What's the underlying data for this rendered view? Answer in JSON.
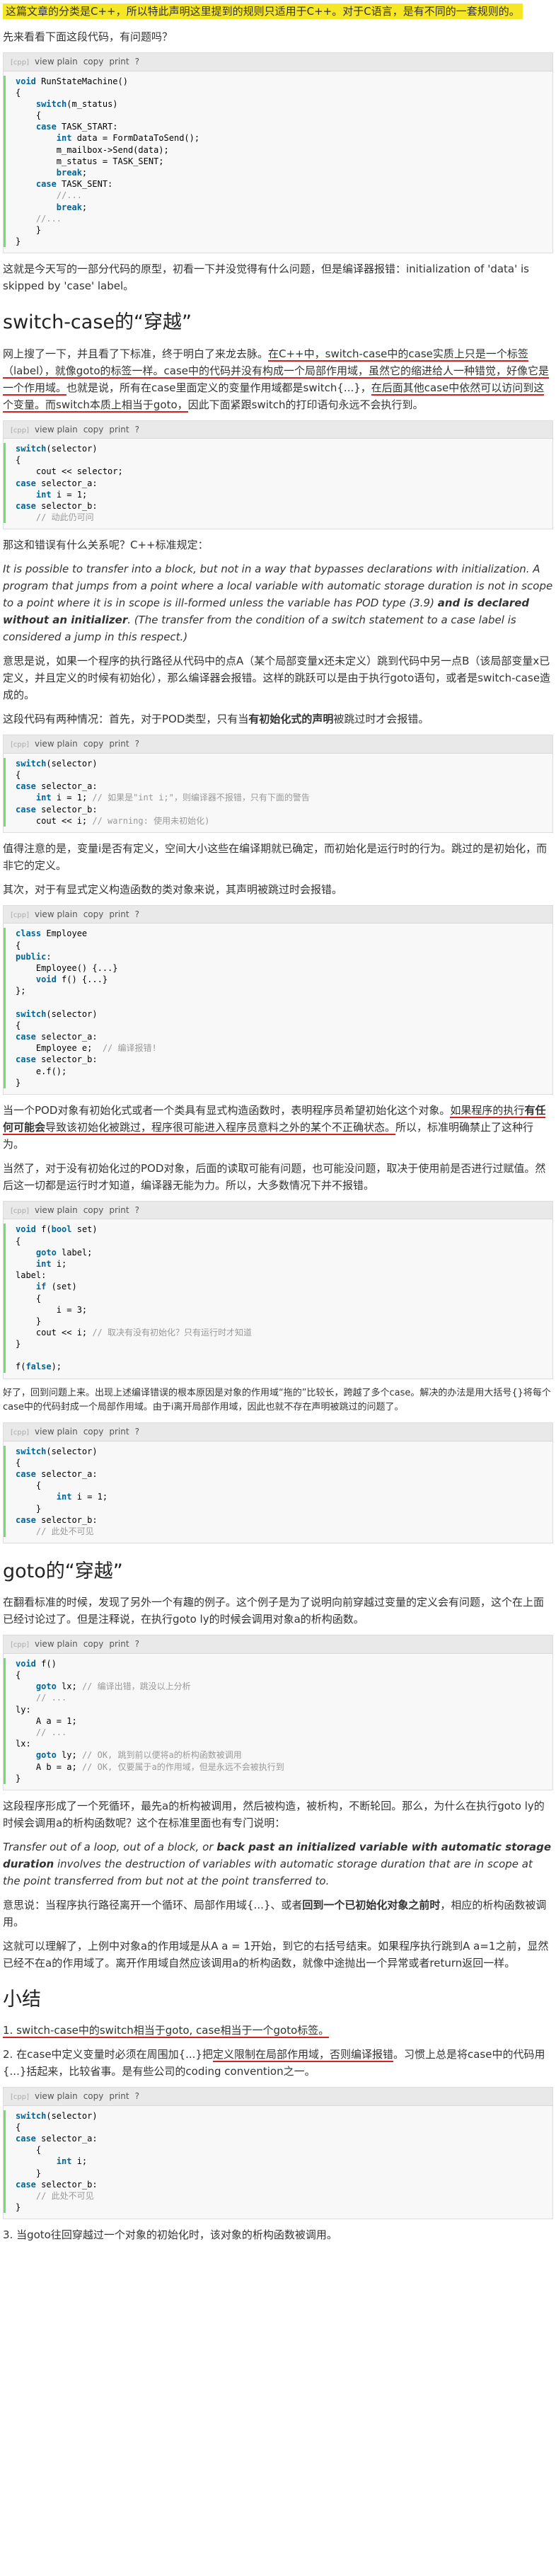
{
  "intro": {
    "highlight": "这篇文章的分类是C++，所以特此声明这里提到的规则只适用于C++。对于C语言，是有不同的一套规则的。",
    "question": "先来看看下面这段代码，有问题吗？"
  },
  "toolbar": {
    "copy_tag": "[cpp]",
    "view_plain": "view plain",
    "copy": "copy",
    "print": "print",
    "help": "?"
  },
  "code1": [
    "void RunStateMachine()",
    "{",
    "    switch(m_status)",
    "    {",
    "    case TASK_START:",
    "        int data = FormDataToSend();",
    "        m_mailbox->Send(data);",
    "        m_status = TASK_SENT;",
    "        break;",
    "    case TASK_SENT:",
    "        //...",
    "        break;",
    "    //...",
    "    }",
    "}"
  ],
  "para1": "这就是今天写的一部分代码的原型，初看一下并没觉得有什么问题，但是编译器报错：initialization of 'data' is skipped by 'case' label。",
  "h_switch": "switch-case的“穿越”",
  "para2": {
    "a": "网上搜了一下，并且看了下标准，终于明白了来龙去脉。",
    "b": "在C++中，switch-case中的case实质上只是一个标签（label），就像goto的标签一样。case中的代码并没有构成一个局部作用域，虽然它的缩进给人一种错觉，好像它是一个作用域。",
    "c": "也就是说，所有在case里面定义的变量作用域都是switch{...}，",
    "d": "在后面其他case中依然可以访问到这个变量。而switch本质上相当于goto，",
    "e": "因此下面紧跟switch的打印语句永远不会执行到。"
  },
  "code2": [
    "switch(selector)",
    "{",
    "    cout << selector;",
    "case selector_a:",
    "    int i = 1;",
    "case selector_b:",
    "    // 动此仍可问"
  ],
  "para3": "那这和错误有什么关系呢？C++标准规定：",
  "quote1": {
    "a": "It is possible to transfer into a block, but not in a way that bypasses declarations with initialization. A program that jumps from a point where a local variable with automatic storage duration is not in scope to a point where it is in scope is ill-formed unless the variable has POD type (3.9) ",
    "b": "and is declared without an initializer",
    "c": ". (The transfer from the condition of a switch statement to a case label is considered a jump in this respect.)"
  },
  "para4": "意思是说，如果一个程序的执行路径从代码中的点A（某个局部变量x还未定义）跳到代码中另一点B（该局部变量x已定义，并且定义的时候有初始化），那么编译器会报错。这样的跳跃可以是由于执行goto语句，或者是switch-case造成的。",
  "para5": {
    "a": "这段代码有两种情况：首先，对于POD类型，只有当",
    "b": "有初始化式的声明",
    "c": "被跳过时才会报错。"
  },
  "code3": [
    "switch(selector)",
    "{",
    "case selector_a:",
    "    int i = 1; // 如果是\"int i;\"，则编译器不报错，只有下面的警告",
    "case selector_b:",
    "    cout << i; // warning: 使用未初始化)"
  ],
  "para6": "值得注意的是，变量i是否有定义，空间大小这些在编译期就已确定，而初始化是运行时的行为。跳过的是初始化，而非它的定义。",
  "para7": "其次，对于有显式定义构造函数的类对象来说，其声明被跳过时会报错。",
  "code4": [
    "class Employee",
    "{",
    "public:",
    "    Employee() {...}",
    "    void f() {...}",
    "};",
    "",
    "switch(selector)",
    "{",
    "case selector_a:",
    "    Employee e;  // 编译报错!",
    "case selector_b:",
    "    e.f();",
    "}"
  ],
  "para8": {
    "a": "当一个POD对象有初始化式或者一个类具有显式构造函数时，表明程序员希望初始化这个对象。",
    "b": "如果程序的执行",
    "c": "有任何可能会",
    "d": "导致该初始化被跳过，程序很可能进入程序员意料之外的某个不正确状态。",
    "e": "所以，标准明确禁止了这种行为。"
  },
  "para9": "当然了，对于没有初始化过的POD对象，后面的读取可能有问题，也可能没问题，取决于使用前是否进行过赋值。然后这一切都是运行时才知道，编译器无能为力。所以，大多数情况下并不报错。",
  "code5": [
    "void f(bool set)",
    "{",
    "    goto label;",
    "    int i;",
    "label:",
    "    if (set)",
    "    {",
    "        i = 3;",
    "    }",
    "    cout << i; // 取决有没有初始化？只有运行时才知道",
    "}",
    "",
    "f(false);"
  ],
  "para10": "好了，回到问题上来。出现上述编译错误的根本原因是对象的作用域“拖的”比较长，跨越了多个case。解决的办法是用大括号{}将每个case中的代码封成一个局部作用域。由于i离开局部作用域，因此也就不存在声明被跳过的问题了。",
  "code6": [
    "switch(selector)",
    "{",
    "case selector_a:",
    "    {",
    "        int i = 1;",
    "    }",
    "case selector_b:",
    "    // 此处不可见"
  ],
  "h_goto": "goto的“穿越”",
  "para11": "在翻看标准的时候，发现了另外一个有趣的例子。这个例子是为了说明向前穿越过变量的定义会有问题，这个在上面已经讨论过了。但是注释说，在执行goto ly的时候会调用对象a的析构函数。",
  "code7": [
    "void f()",
    "{",
    "    goto lx; // 编译出错，跳没以上分析",
    "    // ...",
    "ly:",
    "    A a = 1;",
    "    // ...",
    "lx:",
    "    goto ly; // OK, 跳到前以便将a的析构函数被调用",
    "    A b = a; // OK, 仅要属于a的作用域，但是永远不会被执行到",
    "}"
  ],
  "para12": "这段程序形成了一个死循环，最先a的析构被调用，然后被构造，被析构，不断轮回。那么，为什么在执行goto ly的时候会调用a的析构函数呢？这个在标准里面也有专门说明：",
  "quote2": {
    "a": "Transfer out of a loop, out of a block, or ",
    "b": "back past an initialized variable with automatic storage duration",
    "c": " involves the destruction of variables with automatic storage duration that are in scope at the point transferred from but not at the point transferred to."
  },
  "para13": {
    "a": "意思说：当程序执行路径离开一个循环、局部作用域{...}、或者",
    "b": "回到一个已初始化对象之前时",
    "c": "，相应的析构函数被调用。"
  },
  "para14": "这就可以理解了，上例中对象a的作用域是从A a = 1开始，到它的右括号结束。如果程序执行跳到A a=1之前，显然已经不在a的作用域了。离开作用域自然应该调用a的析构函数，就像中途抛出一个异常或者return返回一样。",
  "h_summary": "小结",
  "summary": {
    "item1_pre": "1. switch-case中的switch相当于goto, case相当于一个goto标签。",
    "item2": {
      "a": "2. 在case中定义变量时必须在周围加{...}把",
      "b": "定义限制在局部作用域，否则编译报错",
      "c": "。习惯上总是将case中的代码用{...}括起来，比较省事。是有些公司的coding convention之一。"
    },
    "item3": "3. 当goto往回穿越过一个对象的初始化时，该对象的析构函数被调用。"
  },
  "code8": [
    "switch(selector)",
    "{",
    "case selector_a:",
    "    {",
    "        int i;",
    "    }",
    "case selector_b:",
    "    // 此处不可见",
    "}"
  ]
}
